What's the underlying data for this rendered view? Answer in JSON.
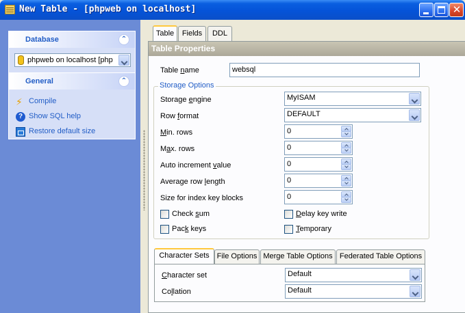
{
  "window": {
    "title": "New Table - [phpweb on localhost]",
    "buttons": {
      "minimize": "minimize",
      "maximize": "maximize",
      "close": "✕"
    }
  },
  "sidebar": {
    "database_panel": {
      "title": "Database",
      "selected_db": "phpweb on localhost [php"
    },
    "general_panel": {
      "title": "General",
      "items": [
        {
          "label": "Compile",
          "icon": "bolt-icon"
        },
        {
          "label": "Show SQL help",
          "icon": "help-icon"
        },
        {
          "label": "Restore default size",
          "icon": "restore-icon"
        }
      ]
    }
  },
  "tabs": [
    "Table",
    "Fields",
    "DDL"
  ],
  "active_tab": "Table",
  "table_properties": {
    "header": "Table Properties",
    "table_name_label": "Table name",
    "table_name_value": "websql",
    "storage_options": {
      "title": "Storage Options",
      "storage_engine_label": "Storage engine",
      "storage_engine_value": "MyISAM",
      "row_format_label": "Row format",
      "row_format_value": "DEFAULT",
      "min_rows_label": "Min. rows",
      "min_rows_value": "0",
      "max_rows_label": "Max. rows",
      "max_rows_value": "0",
      "auto_increment_label": "Auto increment value",
      "auto_increment_value": "0",
      "avg_row_length_label": "Average row length",
      "avg_row_length_value": "0",
      "index_key_blocks_label": "Size for index key blocks",
      "index_key_blocks_value": "0",
      "checkboxes": {
        "check_sum": "Check sum",
        "delay_key_write": "Delay key write",
        "pack_keys": "Pack keys",
        "temporary": "Temporary"
      }
    }
  },
  "subtabs": [
    "Character Sets",
    "File Options",
    "Merge Table Options",
    "Federated Table Options"
  ],
  "active_subtab": "Character Sets",
  "character_sets": {
    "character_set_label": "Character set",
    "character_set_value": "Default",
    "collation_label": "Collation",
    "collation_value": "Default"
  }
}
